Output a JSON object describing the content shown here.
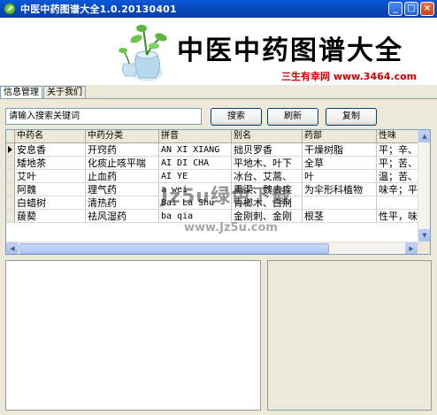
{
  "window": {
    "title": "中医中药图谱大全1.0.20130401",
    "minimize_glyph": "_",
    "maximize_glyph": "□",
    "close_glyph": "×"
  },
  "banner": {
    "title": "中医中药图谱大全",
    "slogan": "三生有幸网 ",
    "url": "www.3464.com"
  },
  "tabs": [
    {
      "label": "信息管理"
    },
    {
      "label": "关于我们"
    }
  ],
  "search": {
    "value": "请输入搜索关键词"
  },
  "toolbar": {
    "search_label": "搜索",
    "refresh_label": "刷新",
    "copy_label": "复制"
  },
  "table": {
    "columns": [
      "中药名",
      "中药分类",
      "拼音",
      "别名",
      "药部",
      "性味"
    ],
    "rows": [
      [
        "安息香",
        "开窍药",
        "AN XI XIANG",
        "拙贝罗香",
        "干燥树脂",
        "平；辛、"
      ],
      [
        "矮地茶",
        "化痰止咳平喘",
        "AI DI CHA",
        "平地木、叶下",
        "全草",
        "平；苦、"
      ],
      [
        "艾叶",
        "止血药",
        "AI YE",
        "冰台、艾蒿、",
        "叶",
        "温；苦、"
      ],
      [
        "阿魏",
        "理气药",
        "a wei",
        "熏渠、魏去疾",
        "为伞形科植物",
        "味辛；平"
      ],
      [
        "白蜡树",
        "清热药",
        "Bai La Shu",
        "青榔木、白荆",
        "",
        ""
      ],
      [
        "菝葜",
        "祛风湿药",
        "ba qia",
        "金刚刺、金刚",
        "根茎",
        "性平，味"
      ]
    ]
  },
  "watermark": {
    "main": "Jz5u绿色下载",
    "sub": "www.Jz5u.com"
  },
  "colors": {
    "titlebar": "#0846b8",
    "accent_red": "#d00000",
    "window_bg": "#ece9d8"
  }
}
